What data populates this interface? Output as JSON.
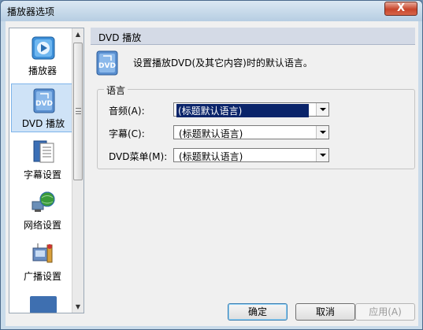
{
  "window": {
    "title": "播放器选项",
    "close_glyph": "X"
  },
  "sidebar": {
    "items": [
      {
        "label": "播放器",
        "icon": "player-icon",
        "active": false
      },
      {
        "label": "DVD 播放",
        "icon": "dvd-icon",
        "active": true
      },
      {
        "label": "字幕设置",
        "icon": "subtitle-icon",
        "active": false
      },
      {
        "label": "网络设置",
        "icon": "network-globe-icon",
        "active": false
      },
      {
        "label": "广播设置",
        "icon": "broadcast-icon",
        "active": false
      }
    ]
  },
  "panel": {
    "header": "DVD 播放",
    "description": "设置播放DVD(及其它内容)时的默认语言。",
    "group_label": "语言",
    "rows": [
      {
        "label": "音频(A):",
        "value": "(标题默认语言)",
        "selected": true
      },
      {
        "label": "字幕(C):",
        "value": "(标题默认语言)",
        "selected": false
      },
      {
        "label": "DVD菜单(M):",
        "value": "(标题默认语言)",
        "selected": false
      }
    ]
  },
  "buttons": {
    "ok": "确定",
    "cancel": "取消",
    "apply": "应用(A)"
  },
  "colors": {
    "accent": "#0a246a",
    "header_bg": "#d4dae6",
    "active_item": "#cfe3f7"
  }
}
